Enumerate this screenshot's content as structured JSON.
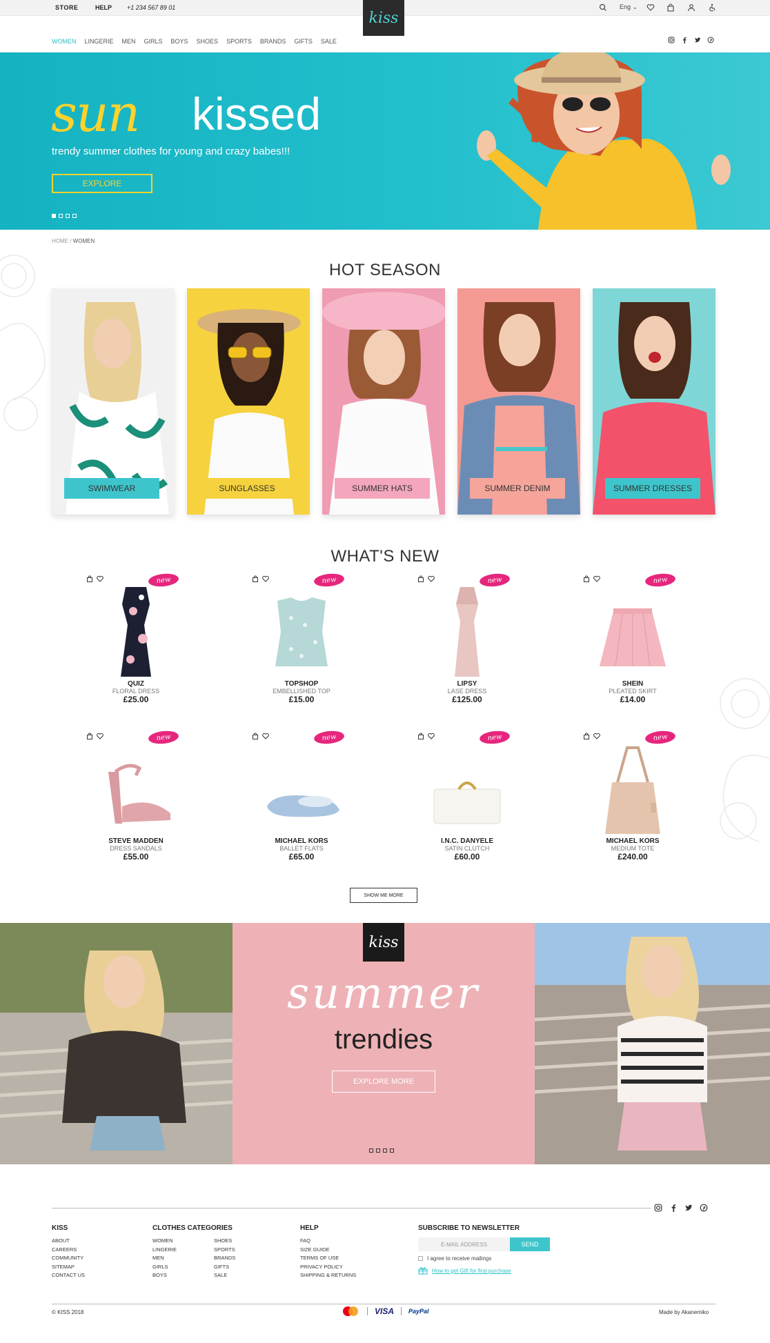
{
  "topbar": {
    "store": "STORE",
    "help": "HELP",
    "phone": "+1 234 567 89 01",
    "language": "Eng",
    "icons": [
      "search-icon",
      "heart-icon",
      "bag-icon",
      "user-icon",
      "accessibility-icon"
    ]
  },
  "logo": {
    "text": "kiss"
  },
  "nav": {
    "items": [
      "WOMEN",
      "LINGERIE",
      "MEN",
      "GIRLS",
      "BOYS",
      "SHOES",
      "SPORTS",
      "BRANDS",
      "GIFTS",
      "SALE"
    ],
    "active": "WOMEN",
    "social_icons": [
      "instagram-icon",
      "facebook-icon",
      "twitter-icon",
      "pinterest-icon"
    ]
  },
  "hero": {
    "script_word": "sun",
    "title_word": "kissed",
    "tagline": "trendy summer clothes for young and crazy babes!!!",
    "button": "EXPLORE",
    "slides": 4,
    "active_slide": 1,
    "colors": {
      "background": "#22bfcd",
      "accent": "#ffd22c"
    }
  },
  "breadcrumb": {
    "home": "HOME",
    "current": "WOMEN"
  },
  "hot_season": {
    "title": "HOT SEASON",
    "categories": [
      {
        "label": "SWIMWEAR",
        "bg": "#f1f1f1",
        "label_bg": "#3ec5cc"
      },
      {
        "label": "SUNGLASSES",
        "bg": "#f6d23e",
        "label_bg": "#f6d23e"
      },
      {
        "label": "SUMMER HATS",
        "bg": "#ef9bb2",
        "label_bg": "#f4a7bc"
      },
      {
        "label": "SUMMER DENIM",
        "bg": "#f59a92",
        "label_bg": "#f6a59b"
      },
      {
        "label": "SUMMER DRESSES",
        "bg": "#7fd6d6",
        "label_bg": "#3ec5cc"
      }
    ]
  },
  "whats_new": {
    "title": "WHAT'S NEW",
    "badge": "new",
    "products": [
      {
        "brand": "QUIZ",
        "name": "FLORAL DRESS",
        "price": "£25.00",
        "kind": "dress-floral"
      },
      {
        "brand": "TOPSHOP",
        "name": "EMBELLISHED TOP",
        "price": "£15.00",
        "kind": "top"
      },
      {
        "brand": "LIPSY",
        "name": "LASE DRESS",
        "price": "£125.00",
        "kind": "dress-pink"
      },
      {
        "brand": "SHEIN",
        "name": "PLEATED SKIRT",
        "price": "£14.00",
        "kind": "skirt"
      },
      {
        "brand": "STEVE MADDEN",
        "name": "DRESS SANDALS",
        "price": "£55.00",
        "kind": "sandal"
      },
      {
        "brand": "MICHAEL KORS",
        "name": "BALLET FLATS",
        "price": "£65.00",
        "kind": "flat"
      },
      {
        "brand": "I.N.C. DANYELE",
        "name": "SATIN CLUTCH",
        "price": "£60.00",
        "kind": "clutch"
      },
      {
        "brand": "MICHAEL KORS",
        "name": "MEDIUM TOTE",
        "price": "£240.00",
        "kind": "tote"
      }
    ],
    "show_more": "SHOW ME MORE"
  },
  "banner": {
    "script_word": "summer",
    "title": "trendies",
    "button": "EXPLORE MORE",
    "slides": 4,
    "colors": {
      "background": "#eeb2b6"
    }
  },
  "footer": {
    "columns": [
      {
        "title": "KISS",
        "items": [
          "ABOUT",
          "CAREERS",
          "COMMUNITY",
          "SITEMAP",
          "CONTACT US"
        ]
      },
      {
        "title": "CLOTHES CATEGORIES",
        "items": [
          "WOMEN",
          "LINGERIE",
          "MEN",
          "GIRLS",
          "BOYS"
        ],
        "items2": [
          "SHOES",
          "SPORTS",
          "BRANDS",
          "GIFTS",
          "SALE"
        ]
      },
      {
        "title": "HELP",
        "items": [
          "FAQ",
          "SIZE GUIDE",
          "TERMS OF USE",
          "PRIVACY POLICY",
          "SHIPPING & RETURNS"
        ]
      }
    ],
    "newsletter": {
      "title": "SUBSCRIBE TO NEWSLETTER",
      "placeholder": "E-MAIL ADDRESS",
      "send": "SEND",
      "agree": "I agree to receive mailings",
      "gift_link": "How to get Gift for first purchase"
    },
    "copyright": "© KISS 2018",
    "payments": [
      "VISA",
      "PayPal"
    ],
    "made_by": "Made by Akanemiko"
  }
}
